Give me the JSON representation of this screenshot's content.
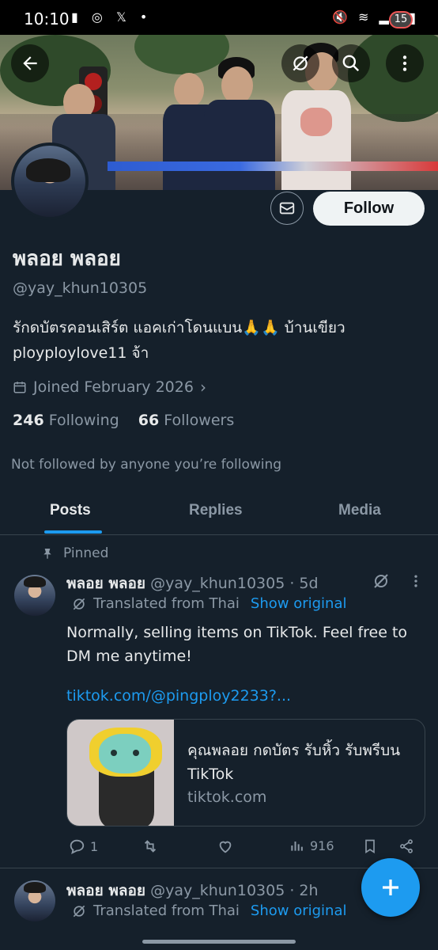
{
  "status_bar": {
    "time": "10:10",
    "battery": "15"
  },
  "profile": {
    "name": "พลอย พลอย",
    "handle": "@yay_khun10305",
    "bio": "รักดบัตรคอนเสิร์ต แอคเก่าโดนแบน🙏🙏 บ้านเขียว ployploylove11 จ้า",
    "joined": "Joined February 2026",
    "following_count": "246",
    "following_label": "Following",
    "followers_count": "66",
    "followers_label": "Followers",
    "not_followed": "Not followed by anyone you’re following",
    "follow_label": "Follow"
  },
  "tabs": [
    {
      "label": "Posts",
      "active": true
    },
    {
      "label": "Replies",
      "active": false
    },
    {
      "label": "Media",
      "active": false
    }
  ],
  "pinned_label": "Pinned",
  "posts": [
    {
      "name": "พลอย พลอย",
      "handle": "@yay_khun10305",
      "time": "· 5d",
      "translated": "Translated from Thai",
      "show_original": "Show original",
      "text": "Normally, selling items on TikTok. Feel free to DM me anytime!",
      "link": "tiktok.com/@pingploy2233?...",
      "card": {
        "title": "คุณพลอย กดบัตร รับหิ้ว รับพรีบน TikTok",
        "domain": "tiktok.com"
      },
      "replies": "1",
      "views": "916"
    },
    {
      "name": "พลอย พลอย",
      "handle": "@yay_khun10305",
      "time": "· 2h",
      "translated": "Translated from Thai",
      "show_original": "Show original"
    }
  ],
  "colors": {
    "background": "#15202b",
    "accent": "#1d9bf0",
    "muted": "#8b98a5",
    "text": "#e7e9ea"
  },
  "icons": [
    "back-arrow-icon",
    "grok-icon",
    "search-icon",
    "more-vertical-icon",
    "mail-icon",
    "calendar-icon",
    "pin-icon",
    "reply-icon",
    "retweet-icon",
    "like-icon",
    "views-icon",
    "bookmark-icon",
    "share-icon",
    "plus-icon"
  ]
}
